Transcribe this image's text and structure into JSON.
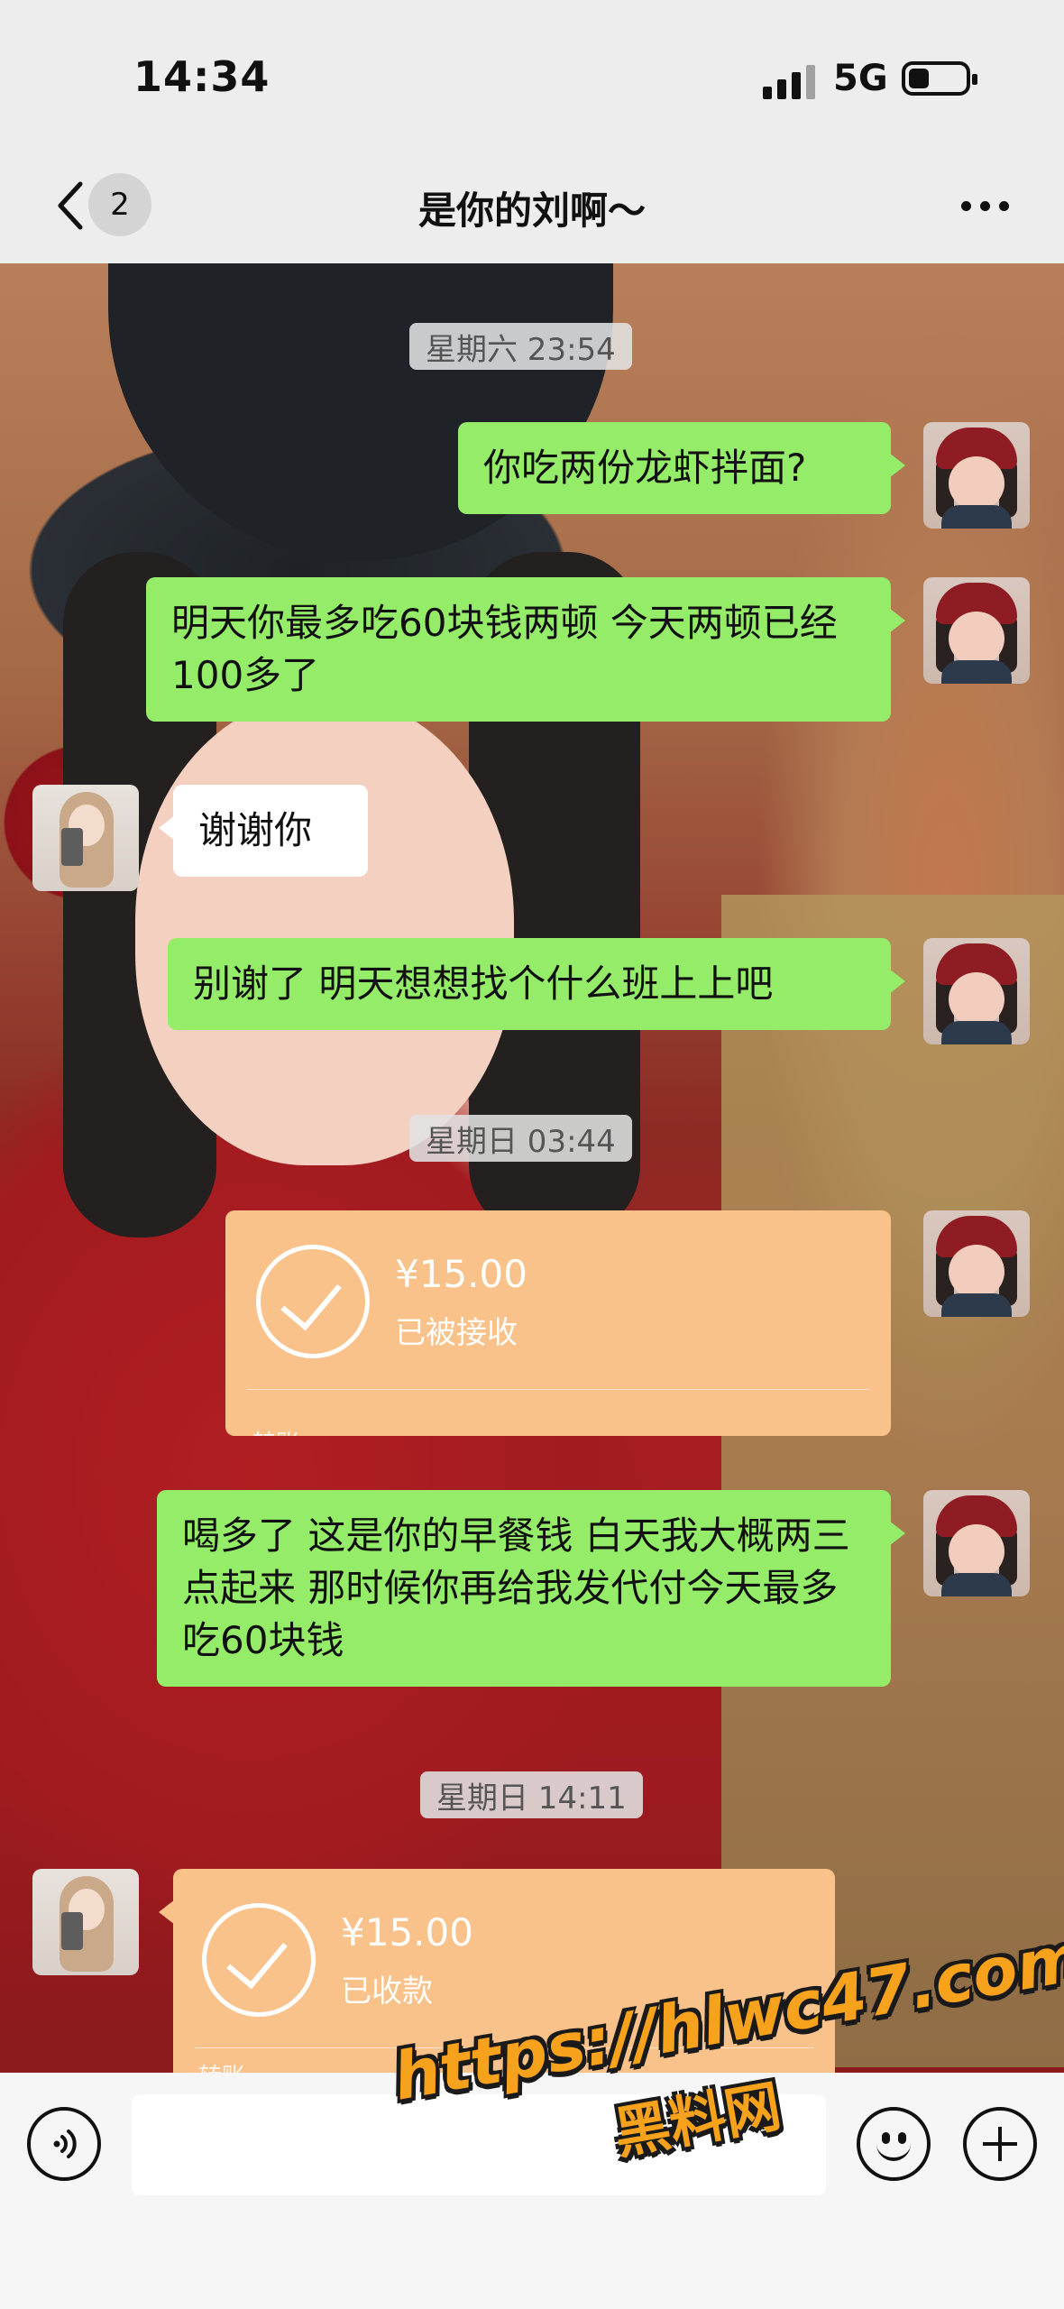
{
  "status_bar": {
    "time": "14:34",
    "network": "5G",
    "icons": [
      "signal-icon",
      "battery-icon"
    ]
  },
  "nav": {
    "back_icon": "chevron-left-icon",
    "unread_count": "2",
    "title": "是你的刘啊～",
    "more_icon": "more-dots-icon"
  },
  "messages": [
    {
      "type": "time",
      "text": "星期六 23:54"
    },
    {
      "type": "text",
      "side": "right",
      "text": "你吃两份龙虾拌面?"
    },
    {
      "type": "text",
      "side": "right",
      "text": "明天你最多吃60块钱两顿 今天两顿已经100多了"
    },
    {
      "type": "text",
      "side": "left",
      "text": "谢谢你"
    },
    {
      "type": "text",
      "side": "right",
      "text": "别谢了 明天想想找个什么班上上吧"
    },
    {
      "type": "time",
      "text": "星期日 03:44"
    },
    {
      "type": "transfer",
      "side": "right",
      "amount": "¥15.00",
      "status": "已被接收",
      "label": "转账"
    },
    {
      "type": "text",
      "side": "right",
      "text": "喝多了 这是你的早餐钱 白天我大概两三点起来 那时候你再给我发代付今天最多吃60块钱"
    },
    {
      "type": "time",
      "text": "星期日 14:11"
    },
    {
      "type": "transfer",
      "side": "left",
      "amount": "¥15.00",
      "status": "已收款",
      "label": "转账"
    }
  ],
  "input_bar": {
    "placeholder": "",
    "voice_icon": "voice-icon",
    "emoji_icon": "emoji-icon",
    "plus_icon": "plus-icon"
  },
  "watermark": {
    "url": "https://hlwc47.com",
    "name": "黑料网"
  },
  "colors": {
    "self_bubble": "#95ec69",
    "other_bubble": "#ffffff",
    "transfer_card": "#f9c28a",
    "watermark": "#f7a21c"
  }
}
